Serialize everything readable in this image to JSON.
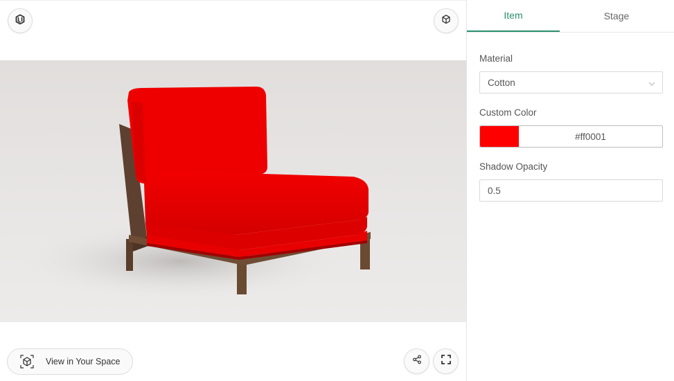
{
  "viewer": {
    "view_in_space_label": "View in Your Space"
  },
  "panel": {
    "tabs": [
      {
        "label": "Item",
        "active": true
      },
      {
        "label": "Stage",
        "active": false
      }
    ],
    "material": {
      "label": "Material",
      "value": "Cotton"
    },
    "custom_color": {
      "label": "Custom Color",
      "value": "#ff0001",
      "swatch": "#ff0001"
    },
    "shadow_opacity": {
      "label": "Shadow Opacity",
      "value": "0.5"
    }
  },
  "colors": {
    "accent": "#2a8f6f",
    "upholstery": "#e60000",
    "frame": "#6b4a32"
  },
  "icons": [
    "logo-icon",
    "ar-cube-icon",
    "view-in-space-icon",
    "share-icon",
    "fullscreen-icon",
    "chevron-down-icon"
  ]
}
